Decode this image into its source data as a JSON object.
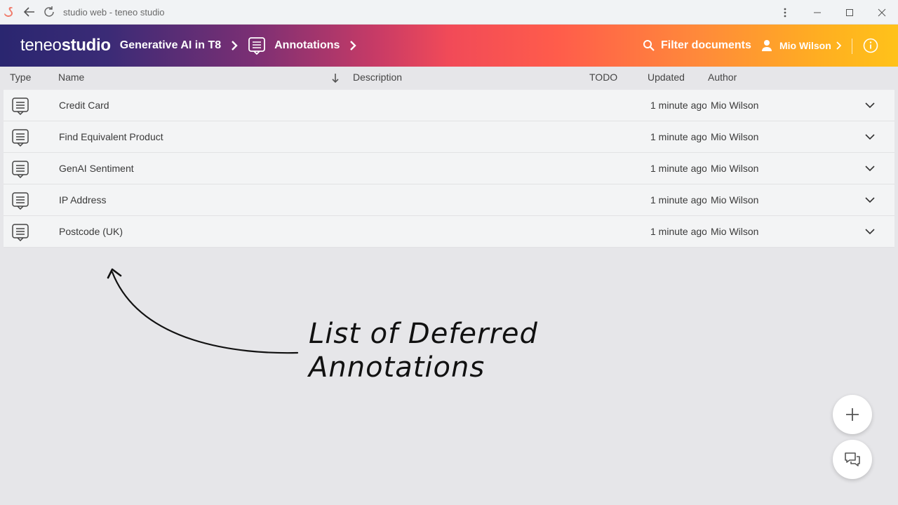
{
  "window": {
    "title": "studio web - teneo studio"
  },
  "header": {
    "logo_thin": "teneo",
    "logo_bold": "studio",
    "breadcrumbs": [
      "Generative AI in T8",
      "Annotations"
    ],
    "filter_label": "Filter documents",
    "user_name": "Mio Wilson"
  },
  "table": {
    "columns": [
      "Type",
      "Name",
      "Description",
      "TODO",
      "Updated",
      "Author"
    ],
    "rows": [
      {
        "name": "Credit Card",
        "updated": "1 minute ago",
        "author": "Mio Wilson"
      },
      {
        "name": "Find Equivalent Product",
        "updated": "1 minute ago",
        "author": "Mio Wilson"
      },
      {
        "name": "GenAI Sentiment",
        "updated": "1 minute ago",
        "author": "Mio Wilson"
      },
      {
        "name": "IP Address",
        "updated": "1 minute ago",
        "author": "Mio Wilson"
      },
      {
        "name": "Postcode (UK)",
        "updated": "1 minute ago",
        "author": "Mio Wilson"
      }
    ]
  },
  "annotation": {
    "line1": "List of Deferred",
    "line2": "Annotations"
  },
  "icons": {
    "app": "flamingo-icon",
    "back": "back-arrow-icon",
    "reload": "reload-icon",
    "menu": "more-vertical-icon",
    "doc": "annotation-document-icon"
  },
  "colors": {
    "gradient_start": "#2a2670",
    "gradient_mid": "#f14a58",
    "gradient_end": "#ffc21a"
  }
}
